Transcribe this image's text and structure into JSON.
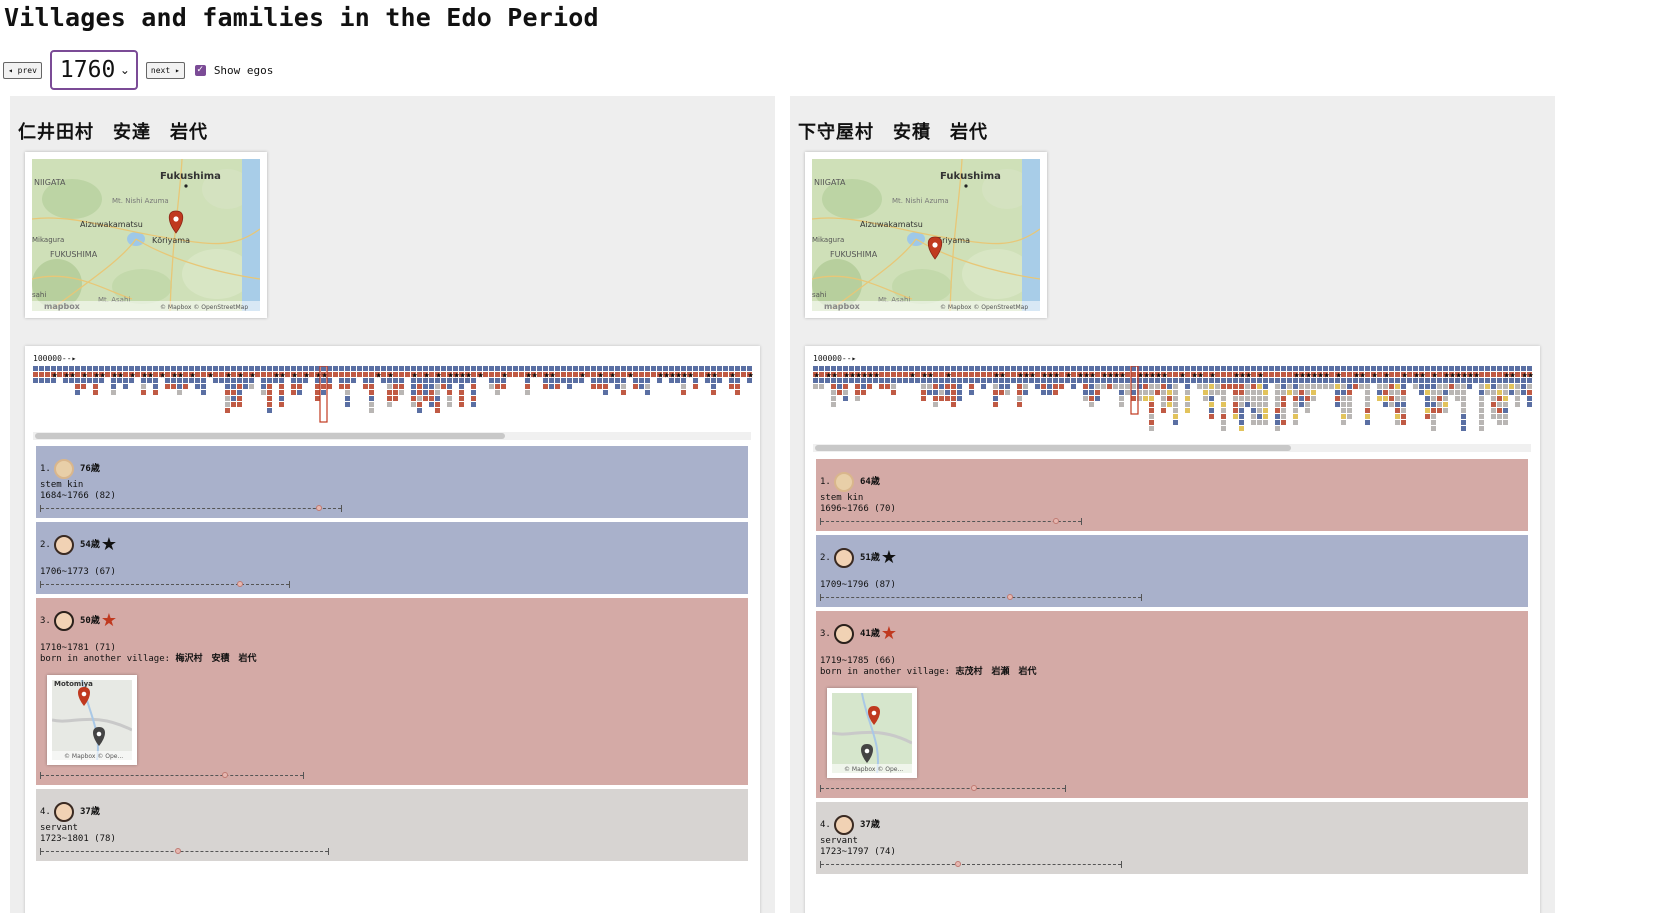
{
  "page": {
    "title": "Villages and families in the Edo Period"
  },
  "controls": {
    "prev_label": "◂ prev",
    "year": "1760",
    "next_label": "next ▸",
    "show_egos_label": "Show egos",
    "show_egos_checked": true
  },
  "colors": {
    "male": "#a9b1cb",
    "female": "#d4aaa6",
    "servant": "#d7d4d2",
    "timeline_male": "#5a6fa3",
    "timeline_female": "#c05a44",
    "timeline_servant": "#b9b6b4",
    "timeline_other": "#e2c35c",
    "accent": "#7b4b96",
    "marker_red": "#c0391f"
  },
  "map_labels": {
    "niigata": "NIIGATA",
    "fukushima_city": "Fukushima",
    "nishi_azuma": "Mt. Nishi Azuma",
    "aizu": "Aizuwakamatsu",
    "koriyama": "Kōriyama",
    "mikagura": "Mikagura",
    "fukushima_pref": "FUKUSHIMA",
    "sahi": "sahi",
    "asahi": "Mt. Asahi",
    "logo": "mapbox",
    "attribution": "© Mapbox © OpenStreetMap",
    "mini_attribution": "© Mapbox © Ope...",
    "mini_top": "Motomiya"
  },
  "villages": [
    {
      "name": "仁井田村　安達　岩代",
      "timeline_label": "100000--▸",
      "members": [
        {
          "num": "1.",
          "age": "76歳",
          "star": "",
          "relation": "stem kin",
          "dates": "1684~1766 (82)",
          "born": ""
        },
        {
          "num": "2.",
          "age": "54歳",
          "star": "★",
          "relation": "",
          "dates": "1706~1773 (67)",
          "born": ""
        },
        {
          "num": "3.",
          "age": "50歳",
          "star": "★",
          "relation": "",
          "dates": "1710~1781 (71)",
          "born_label": "born in another village:",
          "born": "梅沢村　安積　岩代"
        },
        {
          "num": "4.",
          "age": "37歳",
          "star": "",
          "relation": "servant",
          "dates": "1723~1801 (78)",
          "born": ""
        }
      ]
    },
    {
      "name": "下守屋村　安積　岩代",
      "timeline_label": "100000--▸",
      "members": [
        {
          "num": "1.",
          "age": "64歳",
          "star": "",
          "relation": "stem kin",
          "dates": "1696~1766 (70)",
          "born": ""
        },
        {
          "num": "2.",
          "age": "51歳",
          "star": "★",
          "relation": "",
          "dates": "1709~1796 (87)",
          "born": ""
        },
        {
          "num": "3.",
          "age": "41歳",
          "star": "★",
          "relation": "",
          "dates": "1719~1785 (66)",
          "born_label": "born in another village:",
          "born": "志茂村　岩瀬　岩代"
        },
        {
          "num": "4.",
          "age": "37歳",
          "star": "",
          "relation": "servant",
          "dates": "1723~1797 (74)",
          "born": ""
        }
      ]
    }
  ]
}
